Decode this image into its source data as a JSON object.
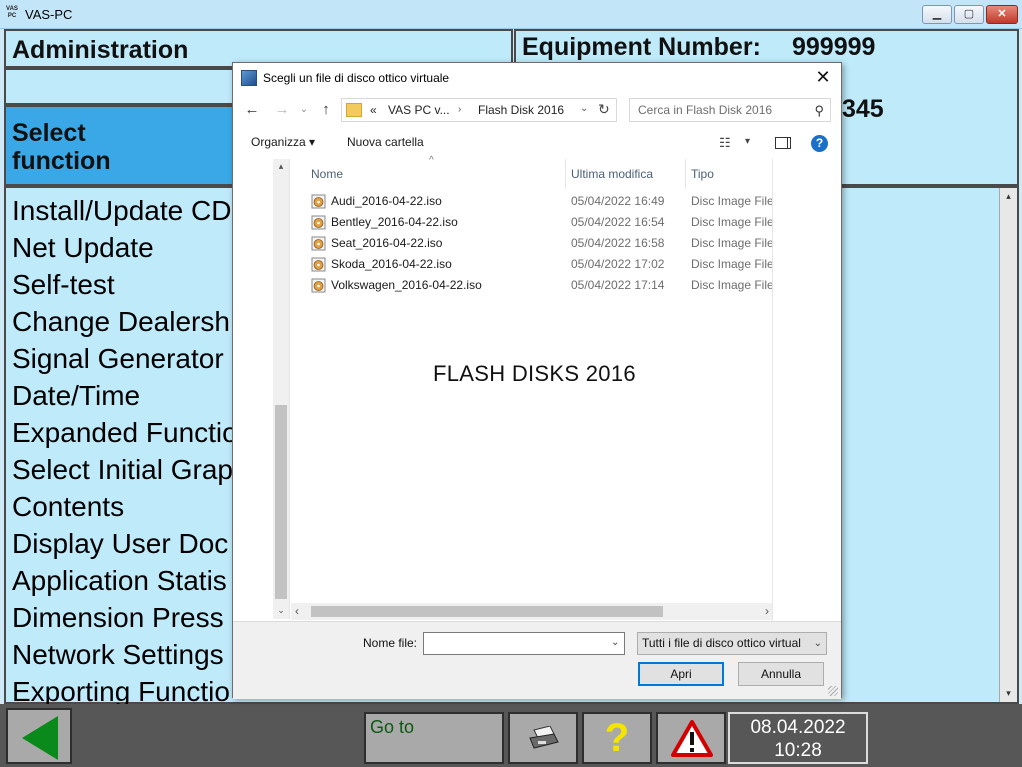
{
  "window": {
    "app_icon_text": "VAS PC",
    "title": "VAS-PC",
    "min": "▁",
    "max": "▢",
    "close": "✕"
  },
  "header": {
    "admin_title": "Administration",
    "equipment_label": "Equipment Number:",
    "equipment_value": "999999",
    "equipment_second_partial": "345",
    "select_function": "Select function"
  },
  "functions": [
    "Install/Update CD",
    "Net Update",
    "Self-test",
    "Change Dealersh",
    "Signal Generator",
    "Date/Time",
    "Expanded Functio",
    "Select Initial Grap",
    "Contents",
    "Display User Doc",
    "Application Statis",
    "Dimension Press",
    "Network Settings",
    "Exporting Functio"
  ],
  "bottom_bar": {
    "goto_label": "Go to",
    "help_symbol": "?",
    "date": "08.04.2022",
    "time": "10:28",
    "colors": {
      "back_arrow": "#0a8a1a",
      "help": "#f5e400",
      "warning": "#d40000"
    }
  },
  "dialog": {
    "title": "Scegli un file di disco ottico virtuale",
    "close": "✕",
    "nav": {
      "back": "←",
      "forward": "→",
      "recent": "⌄",
      "up": "↑"
    },
    "address": {
      "chevrons": "«",
      "segment1": "VAS PC v...",
      "separator": "›",
      "segment2": "Flash Disk 2016",
      "dropdown": "⌄",
      "refresh": "↻"
    },
    "search": {
      "placeholder": "Cerca in Flash Disk 2016",
      "icon": "⚲"
    },
    "toolbar": {
      "organize": "Organizza ▾",
      "new_folder": "Nuova cartella",
      "view_icon": "☷",
      "view_drop": "▾",
      "help": "?"
    },
    "columns": {
      "name": "Nome",
      "modified": "Ultima modifica",
      "type": "Tipo",
      "sort_caret": "^"
    },
    "files": [
      {
        "name": "Audi_2016-04-22.iso",
        "modified": "05/04/2022 16:49",
        "type": "Disc Image File"
      },
      {
        "name": "Bentley_2016-04-22.iso",
        "modified": "05/04/2022 16:54",
        "type": "Disc Image File"
      },
      {
        "name": "Seat_2016-04-22.iso",
        "modified": "05/04/2022 16:58",
        "type": "Disc Image File"
      },
      {
        "name": "Skoda_2016-04-22.iso",
        "modified": "05/04/2022 17:02",
        "type": "Disc Image File"
      },
      {
        "name": "Volkswagen_2016-04-22.iso",
        "modified": "05/04/2022 17:14",
        "type": "Disc Image File"
      }
    ],
    "watermark": "FLASH DISKS 2016",
    "scroll": {
      "up": "▴",
      "down": "⌄",
      "left": "‹",
      "right": "›"
    },
    "filename_label": "Nome file:",
    "filename_value": "",
    "filter": "Tutti i file di disco ottico virtual",
    "filter_drop": "⌄",
    "open_button": "Apri",
    "cancel_button": "Annulla"
  }
}
